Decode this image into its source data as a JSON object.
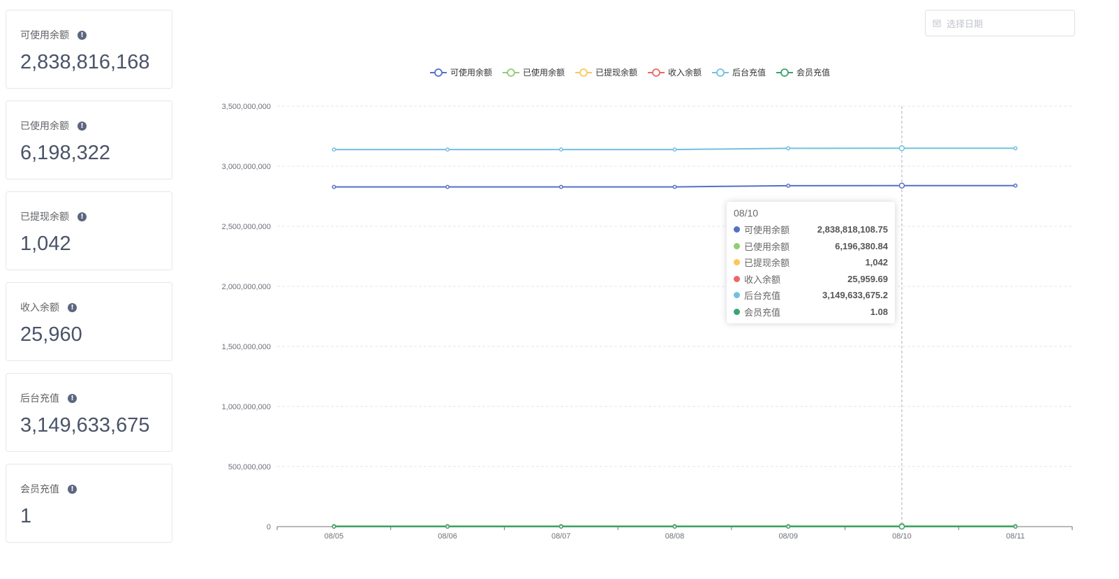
{
  "stats": [
    {
      "title": "可使用余额",
      "value": "2,838,816,168"
    },
    {
      "title": "已使用余额",
      "value": "6,198,322"
    },
    {
      "title": "已提现余额",
      "value": "1,042"
    },
    {
      "title": "收入余额",
      "value": "25,960"
    },
    {
      "title": "后台充值",
      "value": "3,149,633,675"
    },
    {
      "title": "会员充值",
      "value": "1"
    }
  ],
  "date_picker": {
    "placeholder": "选择日期",
    "icon": "calendar-icon"
  },
  "tooltip": {
    "title": "08/10",
    "rows": [
      {
        "name": "可使用余额",
        "value": "2,838,818,108.75",
        "color": "#5470c6"
      },
      {
        "name": "已使用余额",
        "value": "6,196,380.84",
        "color": "#91cc75"
      },
      {
        "name": "已提现余额",
        "value": "1,042",
        "color": "#fac858"
      },
      {
        "name": "收入余额",
        "value": "25,959.69",
        "color": "#ee6666"
      },
      {
        "name": "后台充值",
        "value": "3,149,633,675.2",
        "color": "#73c0de"
      },
      {
        "name": "会员充值",
        "value": "1.08",
        "color": "#3ba272"
      }
    ]
  },
  "chart_data": {
    "type": "line",
    "x": [
      "08/05",
      "08/06",
      "08/07",
      "08/08",
      "08/09",
      "08/10",
      "08/11"
    ],
    "ylim": [
      0,
      3500000000
    ],
    "yticks": [
      "0",
      "500,000,000",
      "1,000,000,000",
      "1,500,000,000",
      "2,000,000,000",
      "2,500,000,000",
      "3,000,000,000",
      "3,500,000,000"
    ],
    "grid": true,
    "legend_position": "top-center",
    "highlighted_x": "08/10",
    "series": [
      {
        "name": "可使用余额",
        "color": "#5470c6",
        "values": [
          2828000000,
          2828000000,
          2828000000,
          2828000000,
          2838000000,
          2838818108.75,
          2838816168
        ]
      },
      {
        "name": "已使用余额",
        "color": "#91cc75",
        "values": [
          6150000,
          6150000,
          6150000,
          6150000,
          6196000,
          6196380.84,
          6198322
        ]
      },
      {
        "name": "已提现余额",
        "color": "#fac858",
        "values": [
          1042,
          1042,
          1042,
          1042,
          1042,
          1042,
          1042
        ]
      },
      {
        "name": "收入余额",
        "color": "#ee6666",
        "values": [
          25900,
          25900,
          25900,
          25900,
          25959,
          25959.69,
          25960
        ]
      },
      {
        "name": "后台充值",
        "color": "#73c0de",
        "values": [
          3139000000,
          3139000000,
          3139000000,
          3139000000,
          3149000000,
          3149633675.2,
          3149633675
        ]
      },
      {
        "name": "会员充值",
        "color": "#3ba272",
        "values": [
          1,
          1,
          1,
          1,
          1,
          1.08,
          1
        ]
      }
    ]
  }
}
